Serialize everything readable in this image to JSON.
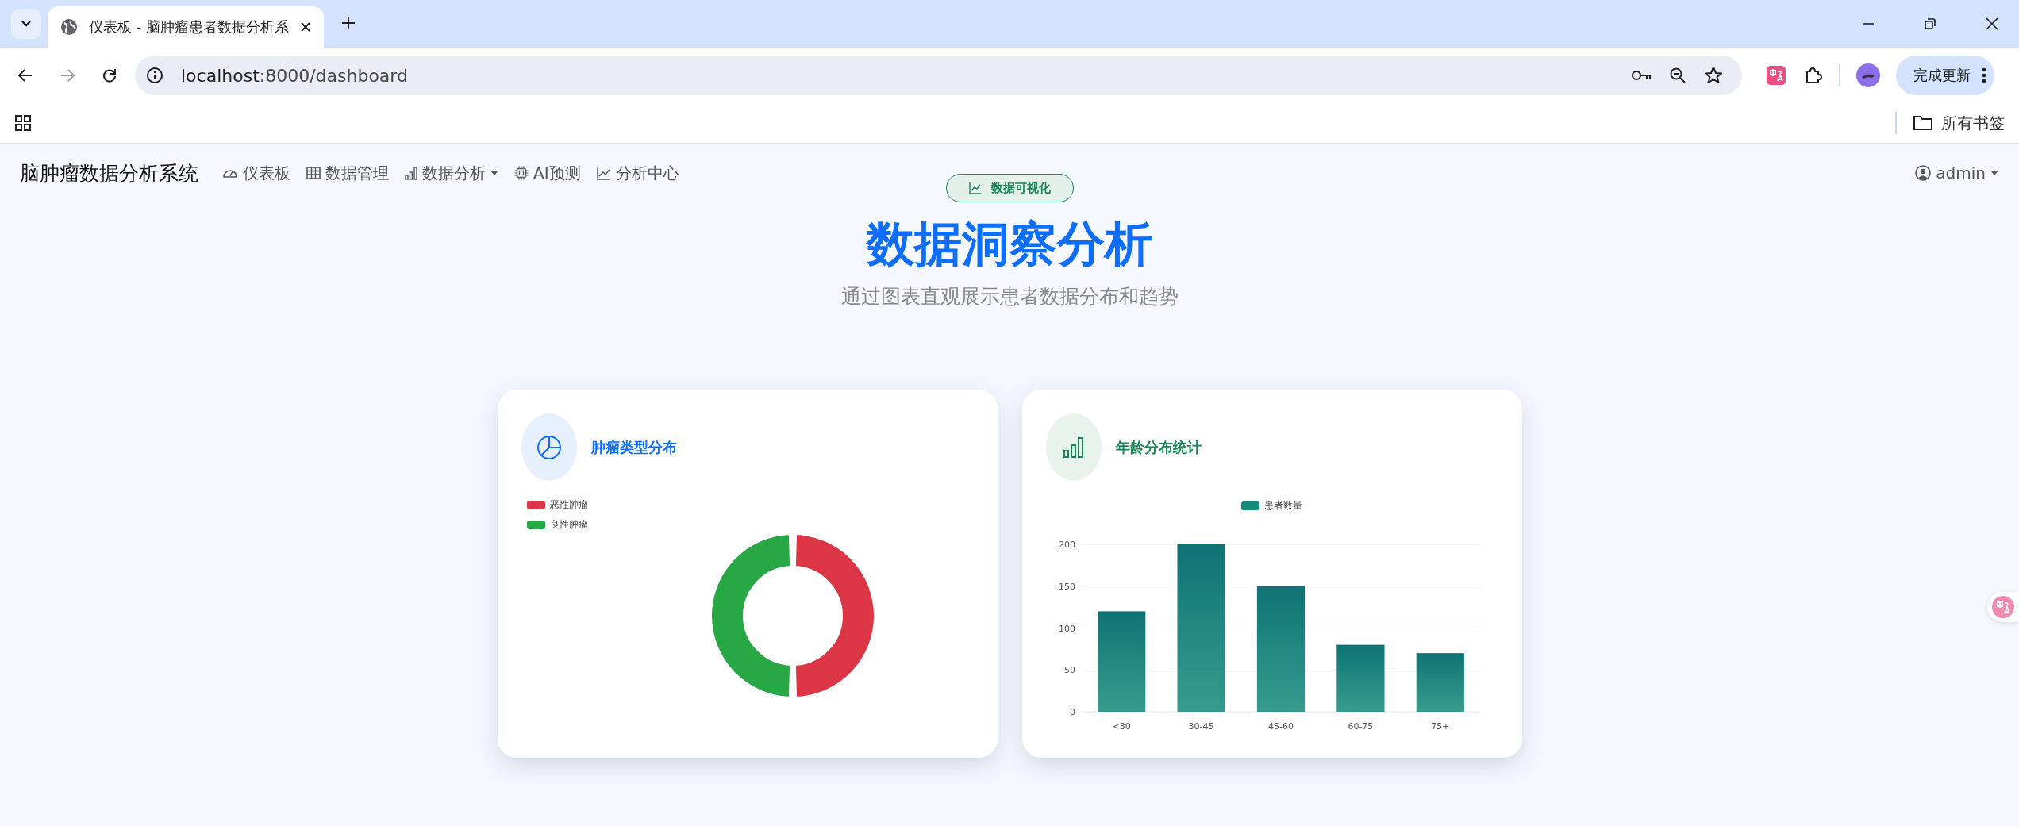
{
  "browser": {
    "tab_title": "仪表板 - 脑肿瘤患者数据分析系",
    "url_host": "localhost",
    "url_rest": ":8000/dashboard",
    "update_button": "完成更新",
    "bookmarks_folder": "所有书签"
  },
  "navbar": {
    "brand": "脑肿瘤数据分析系统",
    "items": [
      {
        "label": "仪表板",
        "kind": "dashboard",
        "dropdown": false
      },
      {
        "label": "数据管理",
        "kind": "table",
        "dropdown": false
      },
      {
        "label": "数据分析",
        "kind": "bars",
        "dropdown": true
      },
      {
        "label": "AI预测",
        "kind": "chip",
        "dropdown": false
      },
      {
        "label": "分析中心",
        "kind": "trend",
        "dropdown": false
      }
    ],
    "user": "admin"
  },
  "hero": {
    "badge": "数据可视化",
    "title": "数据洞察分析",
    "subtitle": "通过图表直观展示患者数据分布和趋势"
  },
  "cards": [
    {
      "title": "肿瘤类型分布",
      "kind": "donut",
      "legend": [
        {
          "label": "恶性肿瘤",
          "color": "#dc3545"
        },
        {
          "label": "良性肿瘤",
          "color": "#28a745"
        }
      ]
    },
    {
      "title": "年龄分布统计",
      "kind": "bar",
      "chart_data": {
        "type": "bar",
        "categories": [
          "<30",
          "30-45",
          "45-60",
          "60-75",
          "75+"
        ],
        "series": [
          {
            "name": "患者数量",
            "color": "#138a7a",
            "values": [
              120,
              200,
              150,
              80,
              70
            ]
          }
        ],
        "ylim": [
          0,
          200
        ],
        "yticks": [
          0,
          50,
          100,
          150,
          200
        ],
        "grid": true
      }
    }
  ]
}
